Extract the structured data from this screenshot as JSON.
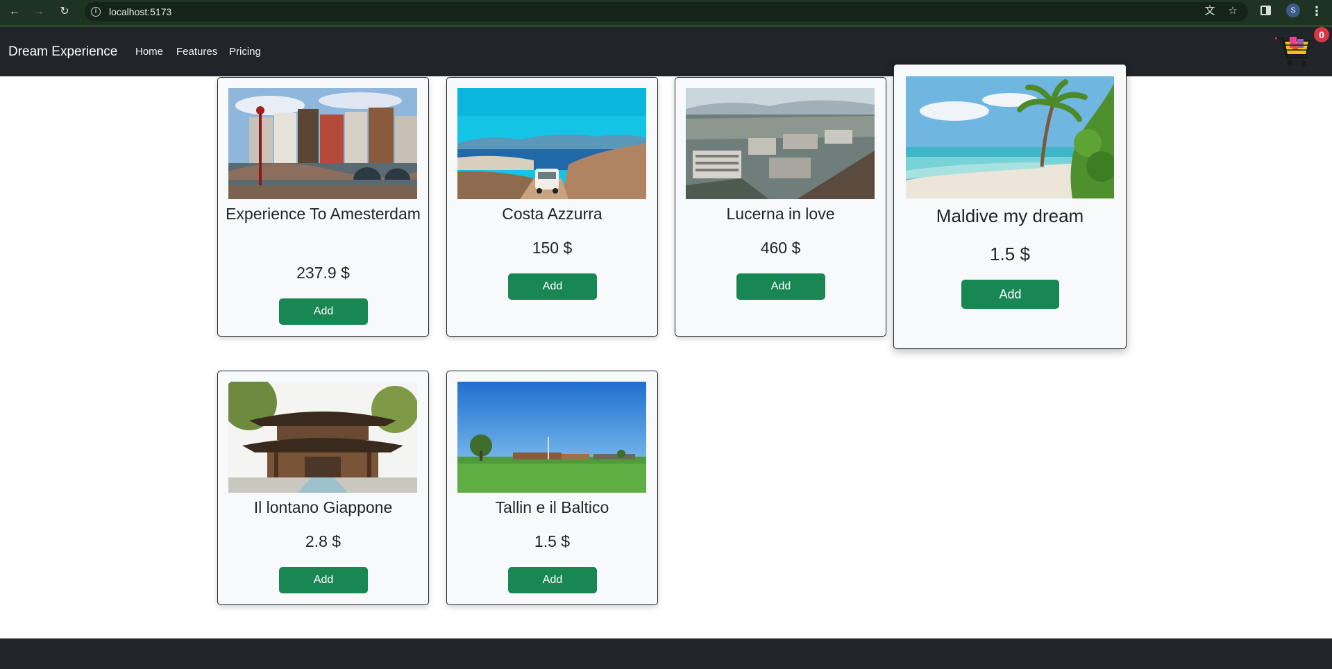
{
  "browser": {
    "url": "localhost:5173",
    "profile_initial": "S"
  },
  "navbar": {
    "brand": "Dream Experience",
    "links": [
      "Home",
      "Features",
      "Pricing"
    ],
    "cart_count": "0"
  },
  "products": [
    {
      "title": "Experience To Amesterdam",
      "price": "237.9 $",
      "button": "Add",
      "image": "amsterdam-canal-houses"
    },
    {
      "title": "Costa Azzurra",
      "price": "150 $",
      "button": "Add",
      "image": "coast-camper-van"
    },
    {
      "title": "Lucerna in love",
      "price": "460 $",
      "button": "Add",
      "image": "lucerne-city-aerial"
    },
    {
      "title": "Maldive my dream",
      "price": "1.5 $",
      "button": "Add",
      "image": "maldives-beach-palm"
    },
    {
      "title": "Il lontano Giappone",
      "price": "2.8 $",
      "button": "Add",
      "image": "japanese-temple-gate"
    },
    {
      "title": "Tallin e il Baltico",
      "price": "1.5 $",
      "button": "Add",
      "image": "green-field-blue-sky"
    }
  ]
}
